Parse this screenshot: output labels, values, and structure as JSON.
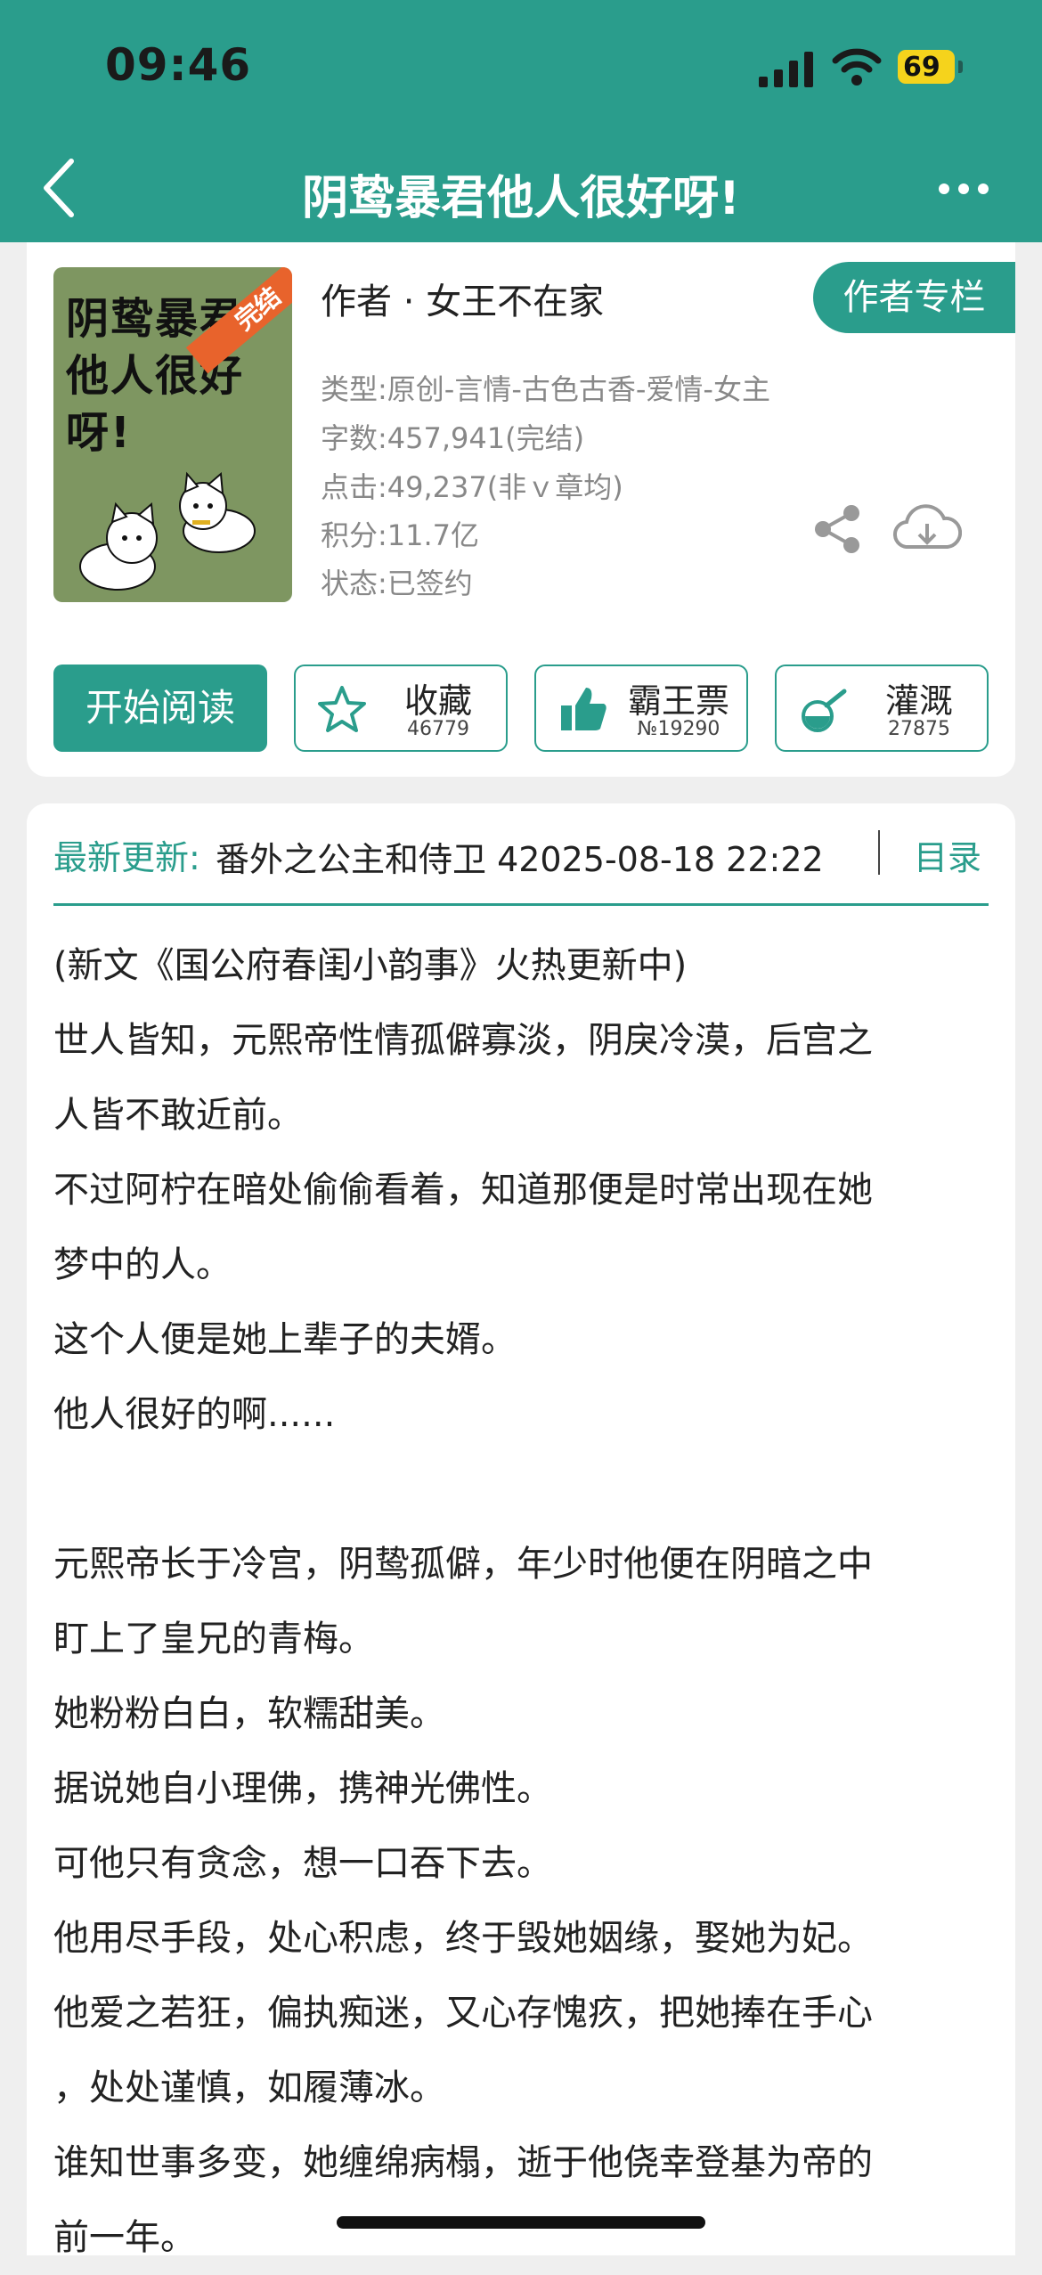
{
  "status_bar": {
    "time": "09:46",
    "battery": "69"
  },
  "nav": {
    "title": "阴鸷暴君他人很好呀!",
    "back_icon": "chevron-left-icon",
    "more_icon": "more-dots-icon"
  },
  "book": {
    "cover": {
      "title_line1": "阴鸷暴君",
      "title_line2": "他人很好",
      "title_line3": "呀!",
      "ribbon": "完结"
    },
    "author": "作者 · 女王不在家",
    "author_column": "作者专栏",
    "meta": {
      "type": "类型:原创-言情-古色古香-爱情-女主",
      "words": "字数:457,941(完结)",
      "clicks": "点击:49,237(非ｖ章均)",
      "points": "积分:11.7亿",
      "status": "状态:已签约"
    }
  },
  "actions": {
    "start_reading": "开始阅读",
    "favorite": {
      "label": "收藏",
      "count": "46779"
    },
    "bawang": {
      "label": "霸王票",
      "count": "№19290"
    },
    "irrigate": {
      "label": "灌溉",
      "count": "27875"
    }
  },
  "update": {
    "label": "最新更新:",
    "text": "番外之公主和侍卫 42025-08-18 22:22",
    "toc": "目录"
  },
  "synopsis": [
    "(新文《国公府春闺小韵事》火热更新中)",
    "世人皆知，元熙帝性情孤僻寡淡，阴戾冷漠，后宫之",
    "人皆不敢近前。",
    "不过阿柠在暗处偷偷看着，知道那便是时常出现在她",
    "梦中的人。",
    "这个人便是她上辈子的夫婿。",
    "他人很好的啊......",
    "",
    "元熙帝长于冷宫，阴鸷孤僻，年少时他便在阴暗之中",
    "盯上了皇兄的青梅。",
    "她粉粉白白，软糯甜美。",
    "据说她自小理佛，携神光佛性。",
    "可他只有贪念，想一口吞下去。",
    "他用尽手段，处心积虑，终于毁她姻缘，娶她为妃。",
    "他爱之若狂，偏执痴迷，又心存愧疚，把她捧在手心",
    "，处处谨慎，如履薄冰。",
    "谁知世事多变，她缠绵病榻，逝于他侥幸登基为帝的",
    "前一年。"
  ],
  "colors": {
    "accent": "#2a9d8c",
    "battery": "#f5d31c",
    "ribbon": "#e8632c"
  }
}
